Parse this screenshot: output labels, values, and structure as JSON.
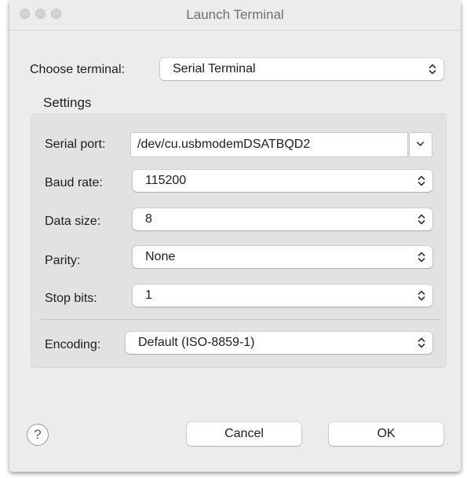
{
  "window": {
    "title": "Launch Terminal"
  },
  "choose_terminal": {
    "label": "Choose terminal:",
    "value": "Serial Terminal"
  },
  "settings": {
    "title": "Settings",
    "serial_port": {
      "label": "Serial port:",
      "value": "/dev/cu.usbmodemDSATBQD2"
    },
    "baud_rate": {
      "label": "Baud rate:",
      "value": "115200"
    },
    "data_size": {
      "label": "Data size:",
      "value": "8"
    },
    "parity": {
      "label": "Parity:",
      "value": "None"
    },
    "stop_bits": {
      "label": "Stop bits:",
      "value": "1"
    },
    "encoding": {
      "label": "Encoding:",
      "value": "Default (ISO-8859-1)"
    }
  },
  "buttons": {
    "help": "?",
    "cancel": "Cancel",
    "ok": "OK"
  },
  "icons": {
    "popup_arrows": "updown-chevron-icon",
    "combo_arrow": "chevron-down-icon",
    "help": "help-icon"
  }
}
